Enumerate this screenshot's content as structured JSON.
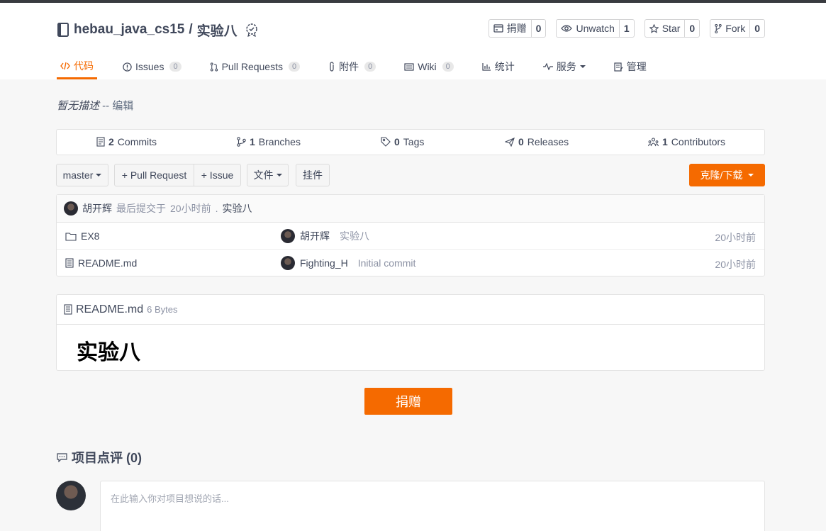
{
  "repo": {
    "owner": "hebau_java_cs15",
    "separator": "/",
    "name": "实验八"
  },
  "actions": [
    {
      "label": "捐赠",
      "count": "0",
      "icon": "donate-icon"
    },
    {
      "label": "Unwatch",
      "count": "1",
      "icon": "eye-icon"
    },
    {
      "label": "Star",
      "count": "0",
      "icon": "star-icon"
    },
    {
      "label": "Fork",
      "count": "0",
      "icon": "fork-icon"
    }
  ],
  "tabs": [
    {
      "label": "代码",
      "icon": "code-icon"
    },
    {
      "label": "Issues",
      "count": "0",
      "icon": "issue-icon"
    },
    {
      "label": "Pull Requests",
      "count": "0",
      "icon": "pull-request-icon"
    },
    {
      "label": "附件",
      "count": "0",
      "icon": "attachment-icon"
    },
    {
      "label": "Wiki",
      "count": "0",
      "icon": "wiki-icon"
    },
    {
      "label": "统计",
      "icon": "stats-icon"
    },
    {
      "label": "服务",
      "icon": "service-icon"
    },
    {
      "label": "管理",
      "icon": "manage-icon"
    }
  ],
  "description": {
    "text": "暂无描述",
    "sep": " -- ",
    "edit": "编辑"
  },
  "stats": [
    {
      "count": "2",
      "label": "Commits",
      "icon": "commits-icon"
    },
    {
      "count": "1",
      "label": "Branches",
      "icon": "branch-icon"
    },
    {
      "count": "0",
      "label": "Tags",
      "icon": "tag-icon"
    },
    {
      "count": "0",
      "label": "Releases",
      "icon": "release-icon"
    },
    {
      "count": "1",
      "label": "Contributors",
      "icon": "contributors-icon"
    }
  ],
  "toolbar": {
    "branch": "master",
    "pull_request": "+ Pull Request",
    "issue": "+ Issue",
    "file": "文件",
    "widget": "挂件",
    "clone": "克隆/下载"
  },
  "last_commit": {
    "author": "胡开辉",
    "text": "最后提交于",
    "time": "20小时前",
    "dot": ".",
    "message": "实验八"
  },
  "files": [
    {
      "name": "EX8",
      "type": "folder-icon",
      "author": "胡开辉",
      "message": "实验八",
      "time": "20小时前"
    },
    {
      "name": "README.md",
      "type": "file-icon",
      "author": "Fighting_H",
      "message": "Initial commit",
      "time": "20小时前"
    }
  ],
  "readme": {
    "filename": "README.md",
    "size": "6 Bytes",
    "heading": "实验八"
  },
  "donate_button": "捐赠",
  "comments": {
    "title": "项目点评 (0)",
    "placeholder": "在此输入你对项目想说的话..."
  },
  "colors": {
    "accent": "#f56a00",
    "text": "#40485b",
    "muted": "#8c92a4"
  }
}
